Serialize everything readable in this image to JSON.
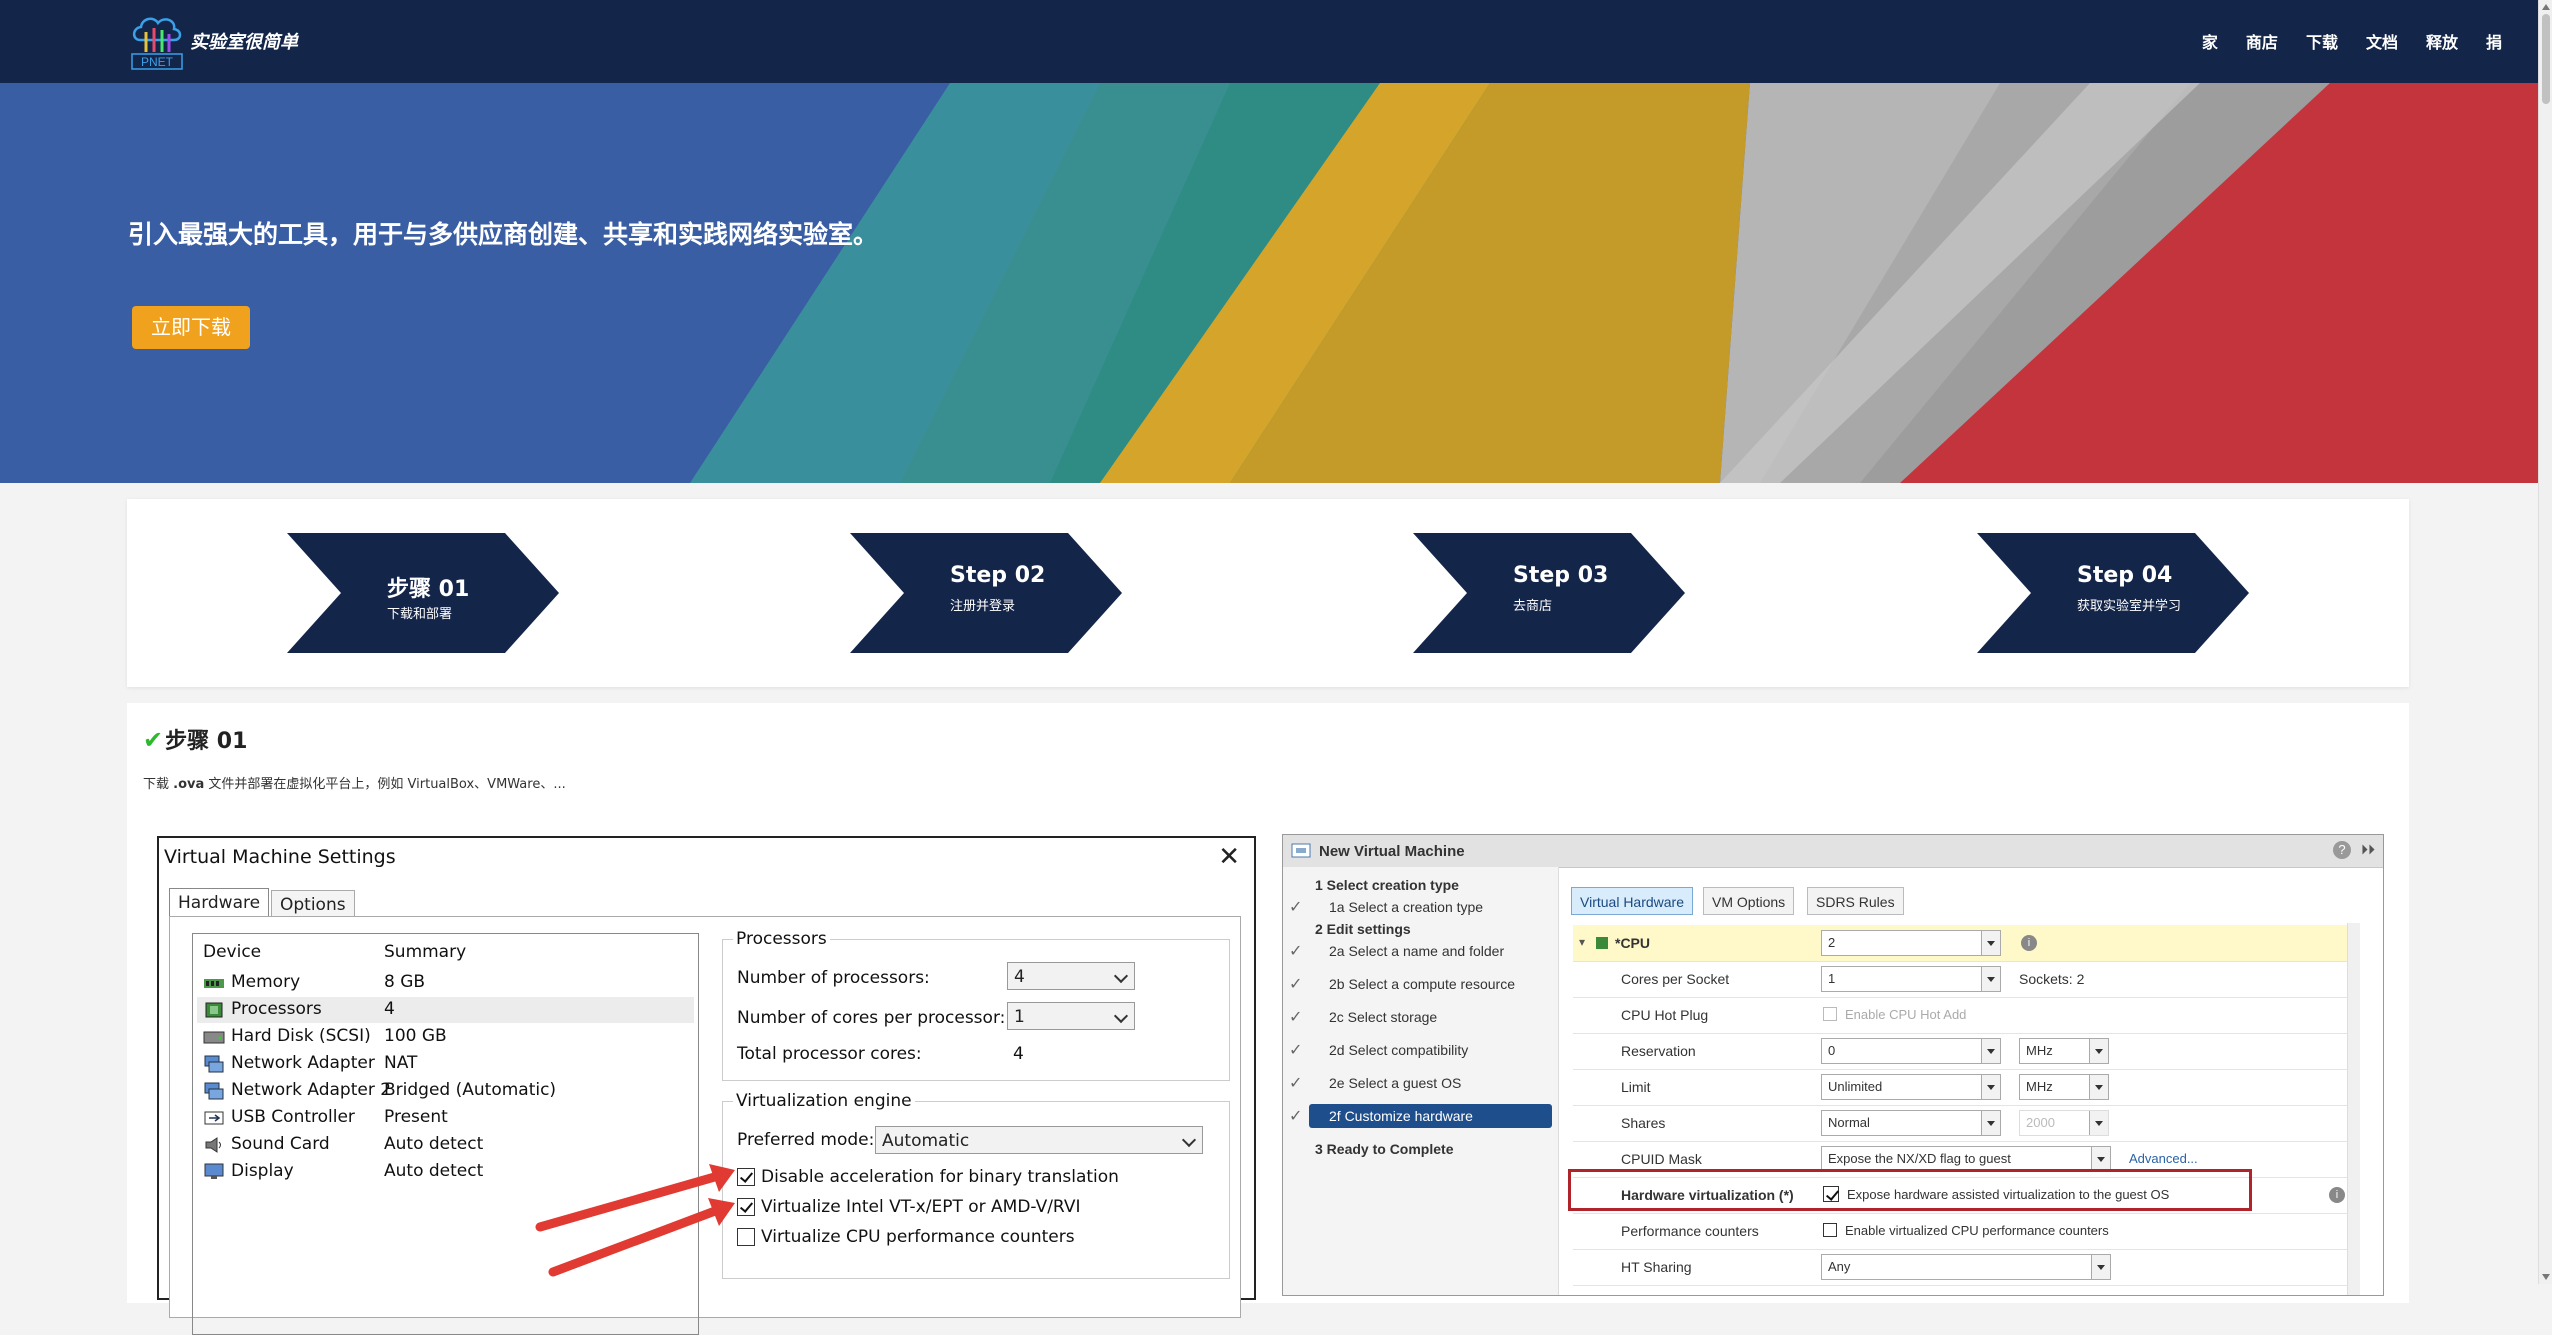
{
  "nav": {
    "brand": "实验室很简单",
    "logo_text": "PNET",
    "links": [
      "家",
      "商店",
      "下载",
      "文档",
      "释放",
      "捐"
    ]
  },
  "hero": {
    "headline": "引入最强大的工具，用于与多供应商创建、共享和实践网络实验室。",
    "download_button": "立即下载"
  },
  "steps": [
    {
      "title": "步骤 01",
      "subtitle": "下载和部署"
    },
    {
      "title": "Step 02",
      "subtitle": "注册并登录"
    },
    {
      "title": "Step 03",
      "subtitle": "去商店"
    },
    {
      "title": "Step 04",
      "subtitle": "获取实验室并学习"
    }
  ],
  "step1": {
    "title": "步骤 01",
    "description_prefix": "下载 ",
    "description_bold": ".ova",
    "description_suffix": " 文件并部署在虚拟化平台上，例如 VirtualBox、VMWare、..."
  },
  "vm_settings": {
    "title": "Virtual Machine Settings",
    "tabs": [
      "Hardware",
      "Options"
    ],
    "columns": [
      "Device",
      "Summary"
    ],
    "devices": [
      {
        "name": "Memory",
        "summary": "8 GB"
      },
      {
        "name": "Processors",
        "summary": "4"
      },
      {
        "name": "Hard Disk (SCSI)",
        "summary": "100 GB"
      },
      {
        "name": "Network Adapter",
        "summary": "NAT"
      },
      {
        "name": "Network Adapter 2",
        "summary": "Bridged (Automatic)"
      },
      {
        "name": "USB Controller",
        "summary": "Present"
      },
      {
        "name": "Sound Card",
        "summary": "Auto detect"
      },
      {
        "name": "Display",
        "summary": "Auto detect"
      }
    ],
    "processors": {
      "legend": "Processors",
      "num_processors_label": "Number of processors:",
      "num_processors_value": "4",
      "cores_label": "Number of cores per processor:",
      "cores_value": "1",
      "total_label": "Total processor cores:",
      "total_value": "4"
    },
    "virtualization": {
      "legend": "Virtualization engine",
      "mode_label": "Preferred mode:",
      "mode_value": "Automatic",
      "options": [
        {
          "label": "Disable acceleration for binary translation",
          "checked": true
        },
        {
          "label": "Virtualize Intel VT-x/EPT or AMD-V/RVI",
          "checked": true
        },
        {
          "label": "Virtualize CPU performance counters",
          "checked": false
        }
      ]
    }
  },
  "new_vm": {
    "title": "New Virtual Machine",
    "steps": [
      {
        "label": "1  Select creation type",
        "bold": true
      },
      {
        "label": "1a  Select a creation type",
        "bold": false,
        "done": true
      },
      {
        "label": "2  Edit settings",
        "bold": true
      },
      {
        "label": "2a  Select a name and folder",
        "bold": false,
        "done": true
      },
      {
        "label": "2b  Select a compute resource",
        "bold": false,
        "done": true
      },
      {
        "label": "2c  Select storage",
        "bold": false,
        "done": true
      },
      {
        "label": "2d  Select compatibility",
        "bold": false,
        "done": true
      },
      {
        "label": "2e  Select a guest OS",
        "bold": false,
        "done": true
      },
      {
        "label": "2f  Customize hardware",
        "bold": false,
        "done": true,
        "current": true
      },
      {
        "label": "3  Ready to Complete",
        "bold": true
      }
    ],
    "tabs": [
      "Virtual Hardware",
      "VM Options",
      "SDRS Rules"
    ],
    "cpu": {
      "label": "*CPU",
      "value": "2",
      "cores_label": "Cores per Socket",
      "cores_value": "1",
      "sockets_text": "Sockets:  2",
      "hotplug_label": "CPU Hot Plug",
      "hotplug_text": "Enable CPU Hot Add",
      "reservation_label": "Reservation",
      "reservation_value": "0",
      "reservation_unit": "MHz",
      "limit_label": "Limit",
      "limit_value": "Unlimited",
      "limit_unit": "MHz",
      "shares_label": "Shares",
      "shares_value": "Normal",
      "shares_num": "2000",
      "cpuid_label": "CPUID Mask",
      "cpuid_value": "Expose the NX/XD flag to guest",
      "advanced": "Advanced...",
      "hv_label": "Hardware virtualization (*)",
      "hv_text": "Expose hardware assisted virtualization to the guest OS",
      "perf_label": "Performance counters",
      "perf_text": "Enable virtualized CPU performance counters",
      "ht_label": "HT Sharing",
      "ht_value": "Any"
    }
  },
  "colors": {
    "nav_bg": "#14254a",
    "step_bg": "#14254a",
    "button_orange": "#f0a21e",
    "check_green": "#2db82d",
    "annotation_red": "#e03a32"
  }
}
